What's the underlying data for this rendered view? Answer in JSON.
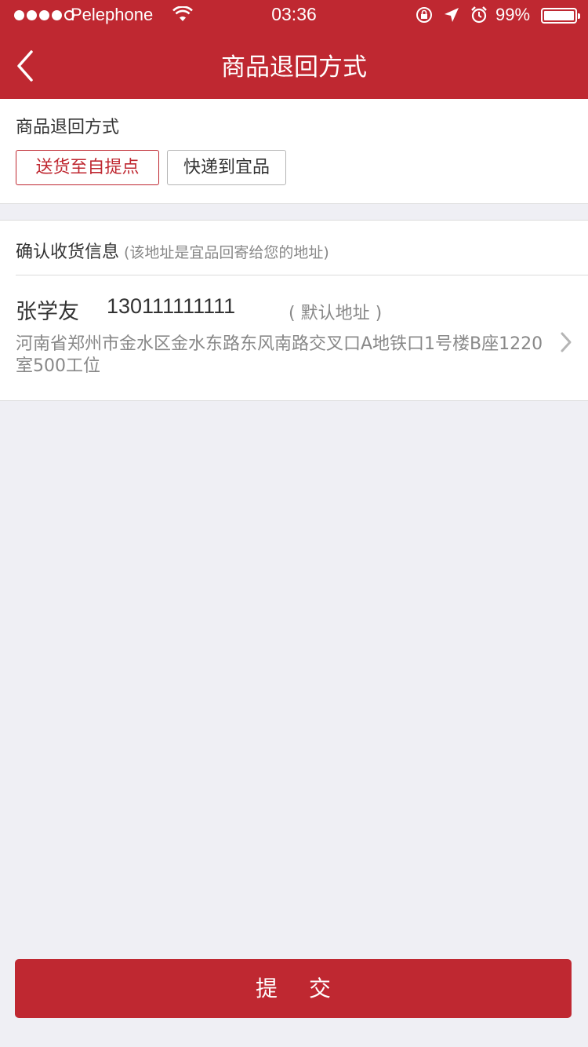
{
  "status_bar": {
    "carrier": "Pelephone",
    "time": "03:36",
    "battery_percent": "99%",
    "battery_level": 0.99,
    "signal_bars_filled": 4,
    "signal_bars_total": 5
  },
  "nav": {
    "title": "商品退回方式",
    "back_icon": "chevron-left-icon"
  },
  "return_method": {
    "label": "商品退回方式",
    "options": [
      {
        "label": "送货至自提点",
        "selected": true
      },
      {
        "label": "快递到宜品",
        "selected": false
      }
    ]
  },
  "receiver": {
    "header": "确认收货信息",
    "hint": "(该地址是宜品回寄给您的地址)",
    "name": "张学友",
    "phone": "130111111111",
    "default_tag": "( 默认地址 )",
    "address": "河南省郑州市金水区金水东路东风南路交叉口A地铁口1号楼B座1220室500工位"
  },
  "submit_label": "提交",
  "colors": {
    "brand_red": "#bf2831",
    "background": "#efeff4",
    "text_primary": "#333333",
    "text_secondary": "#888888"
  }
}
